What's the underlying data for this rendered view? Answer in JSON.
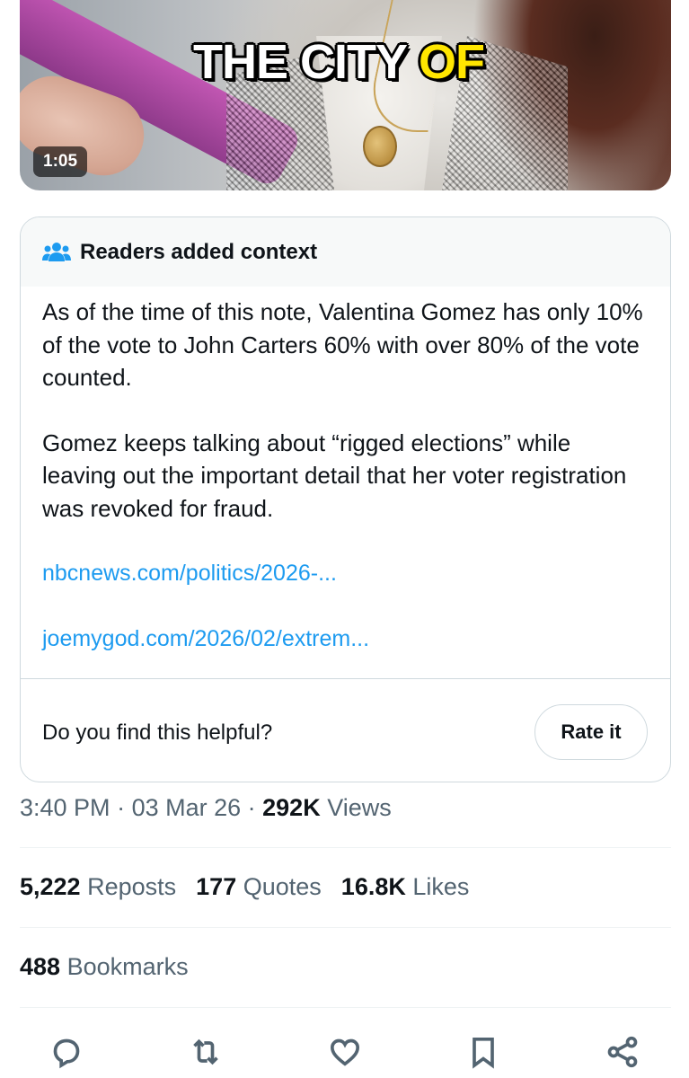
{
  "video": {
    "caption_part1": "THE CITY ",
    "caption_part2": "OF",
    "duration": "1:05",
    "caption_highlight_color": "#ffe600"
  },
  "note": {
    "header_icon": "people-icon",
    "header_title": "Readers added context",
    "paragraph1": "As of the time of this note, Valentina Gomez has only 10% of the vote to John Carters 60% with over 80% of the vote counted.",
    "paragraph2": "Gomez keeps talking about “rigged elections” while leaving out the important detail that her voter registration was revoked for fraud.",
    "link1": "nbcnews.com/politics/2026-...",
    "link2": "joemygod.com/2026/02/extrem...",
    "helpful_question": "Do you find this helpful?",
    "rate_button": "Rate it",
    "link_color": "#1d9bf0"
  },
  "meta": {
    "time": "3:40 PM",
    "date": "03 Mar 26",
    "views_count": "292K",
    "views_label": "Views",
    "separator": " · "
  },
  "stats": {
    "reposts_count": "5,222",
    "reposts_label": "Reposts",
    "quotes_count": "177",
    "quotes_label": "Quotes",
    "likes_count": "16.8K",
    "likes_label": "Likes",
    "bookmarks_count": "488",
    "bookmarks_label": "Bookmarks"
  },
  "actions": {
    "icons": [
      "reply-icon",
      "repost-icon",
      "like-icon",
      "bookmark-icon",
      "share-icon"
    ],
    "icon_color": "#536471"
  }
}
